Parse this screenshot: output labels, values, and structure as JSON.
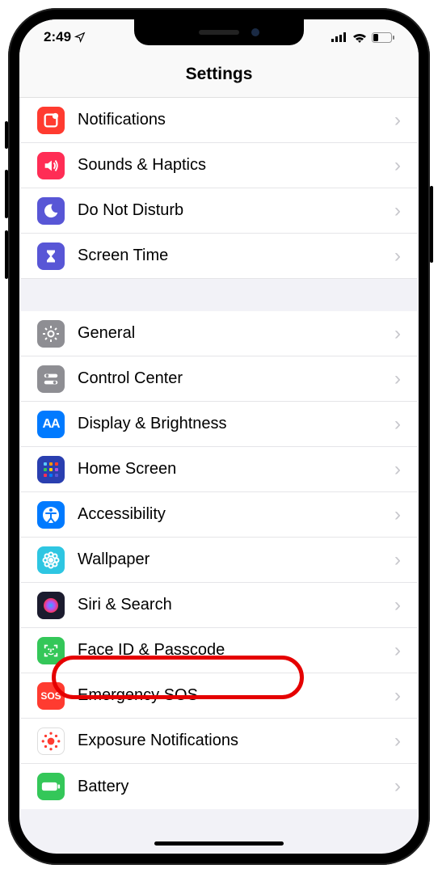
{
  "status": {
    "time": "2:49",
    "location_icon": "➤"
  },
  "header": {
    "title": "Settings"
  },
  "groups": [
    {
      "items": [
        {
          "id": "notifications",
          "label": "Notifications",
          "bg": "#ff3b30",
          "icon": "notif"
        },
        {
          "id": "sounds",
          "label": "Sounds & Haptics",
          "bg": "#ff2d55",
          "icon": "sound"
        },
        {
          "id": "dnd",
          "label": "Do Not Disturb",
          "bg": "#5856d6",
          "icon": "moon"
        },
        {
          "id": "screentime",
          "label": "Screen Time",
          "bg": "#5856d6",
          "icon": "hourglass"
        }
      ]
    },
    {
      "items": [
        {
          "id": "general",
          "label": "General",
          "bg": "#8e8e93",
          "icon": "gear"
        },
        {
          "id": "control",
          "label": "Control Center",
          "bg": "#8e8e93",
          "icon": "switches"
        },
        {
          "id": "display",
          "label": "Display & Brightness",
          "bg": "#007aff",
          "icon": "aa"
        },
        {
          "id": "home",
          "label": "Home Screen",
          "bg": "#2a3fb0",
          "icon": "grid"
        },
        {
          "id": "accessibility",
          "label": "Accessibility",
          "bg": "#007aff",
          "icon": "access"
        },
        {
          "id": "wallpaper",
          "label": "Wallpaper",
          "bg": "#2ec6e2",
          "icon": "flower"
        },
        {
          "id": "siri",
          "label": "Siri & Search",
          "bg": "#1b1b2e",
          "icon": "siri"
        },
        {
          "id": "faceid",
          "label": "Face ID & Passcode",
          "bg": "#34c759",
          "icon": "face"
        },
        {
          "id": "sos",
          "label": "Emergency SOS",
          "bg": "#ff3b30",
          "icon": "sos"
        },
        {
          "id": "exposure",
          "label": "Exposure Notifications",
          "bg": "#fff",
          "icon": "exposure",
          "border": true
        },
        {
          "id": "battery",
          "label": "Battery",
          "bg": "#34c759",
          "icon": "battery"
        }
      ]
    }
  ],
  "highlighted_item": "faceid"
}
